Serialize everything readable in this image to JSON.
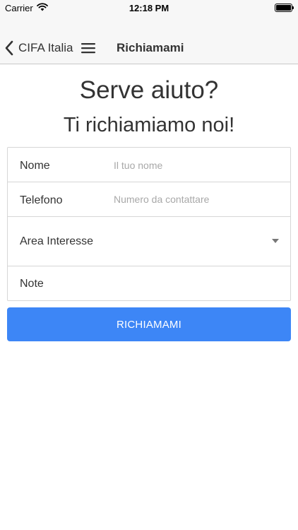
{
  "status_bar": {
    "carrier": "Carrier",
    "time": "12:18 PM"
  },
  "nav": {
    "back_label": "CIFA Italia",
    "title": "Richiamami"
  },
  "header": {
    "title": "Serve aiuto?",
    "subtitle": "Ti richiamiamo noi!"
  },
  "form": {
    "fields": [
      {
        "label": "Nome",
        "placeholder": "Il tuo nome",
        "value": ""
      },
      {
        "label": "Telefono",
        "placeholder": "Numero da contattare",
        "value": ""
      },
      {
        "label": "Area Interesse",
        "type": "select"
      },
      {
        "label": "Note"
      }
    ],
    "submit_label": "RICHIAMAMI"
  },
  "colors": {
    "accent": "#3d86f6",
    "nav_background": "#f7f7f7"
  },
  "icons": {
    "back": "chevron-left-icon",
    "menu": "hamburger-menu-icon",
    "wifi": "wifi-icon",
    "battery": "battery-icon",
    "dropdown": "triangle-down-icon"
  }
}
